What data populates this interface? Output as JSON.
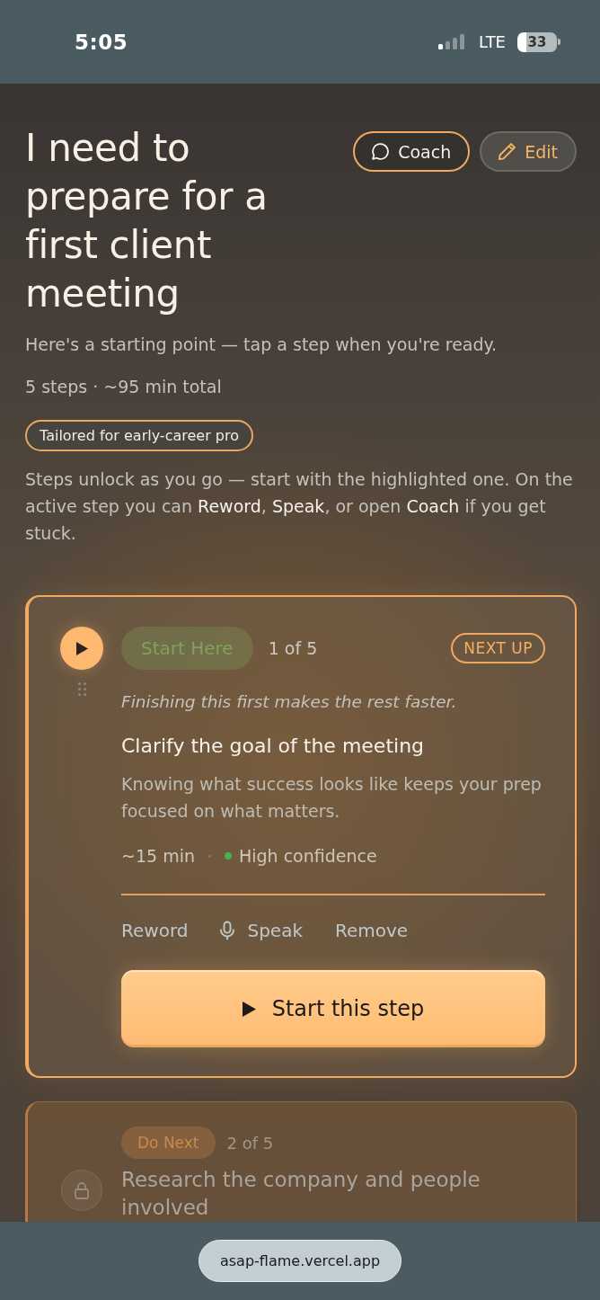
{
  "status_bar": {
    "time": "5:05",
    "network": "LTE",
    "battery": "33"
  },
  "header": {
    "title": "I need to prepare for a first client meeting",
    "buttons": [
      {
        "label": "Coach",
        "kind": "chat"
      },
      {
        "label": "Edit",
        "kind": "edit"
      }
    ]
  },
  "intro": {
    "subtitle": "Here's a starting point — tap a step when you're ready.",
    "summary": "5 steps · ~95 min total",
    "tag": "Tailored for early-career pro",
    "note": "Steps unlock as you go — start with the highlighted one. On the active step you can **Reword**, **Speak**, or open **Coach** if you get stuck."
  },
  "steps": [
    {
      "locked": false,
      "badge": {
        "label": "Start Here",
        "color": "#7ea35f"
      },
      "position": "1 of 5",
      "status": "NEXT UP",
      "reason": "Finishing this first makes the rest faster.",
      "title": "Clarify the goal of the meeting",
      "description": "Knowing what success looks like keeps your prep focused on what matters.",
      "duration": "~15 min",
      "confidence": {
        "label": "High confidence",
        "color": "#4caf50"
      },
      "actions": [
        {
          "label": "Reword",
          "kind": "plain"
        },
        {
          "label": "Speak",
          "kind": "voice"
        },
        {
          "label": "Remove",
          "kind": "plain"
        }
      ],
      "primary_action": "Start this step"
    },
    {
      "locked": true,
      "badge": {
        "label": "Do Next",
        "color": "#c8894f"
      },
      "position": "2 of 5",
      "title": "Research the company and people involved"
    }
  ],
  "browser": {
    "url": "asap-flame.vercel.app"
  }
}
